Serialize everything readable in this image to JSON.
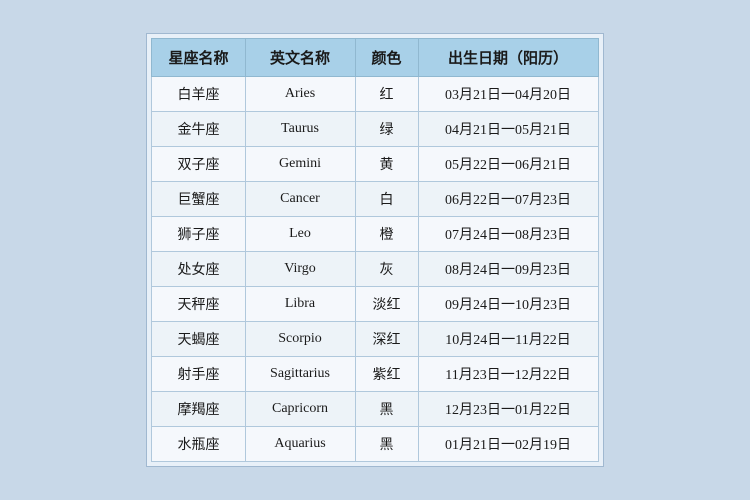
{
  "table": {
    "headers": {
      "chinese_name": "星座名称",
      "english_name": "英文名称",
      "color": "颜色",
      "birth_date": "出生日期（阳历）"
    },
    "rows": [
      {
        "chinese": "白羊座",
        "english": "Aries",
        "color": "红",
        "date": "03月21日一04月20日"
      },
      {
        "chinese": "金牛座",
        "english": "Taurus",
        "color": "绿",
        "date": "04月21日一05月21日"
      },
      {
        "chinese": "双子座",
        "english": "Gemini",
        "color": "黄",
        "date": "05月22日一06月21日"
      },
      {
        "chinese": "巨蟹座",
        "english": "Cancer",
        "color": "白",
        "date": "06月22日一07月23日"
      },
      {
        "chinese": "狮子座",
        "english": "Leo",
        "color": "橙",
        "date": "07月24日一08月23日"
      },
      {
        "chinese": "处女座",
        "english": "Virgo",
        "color": "灰",
        "date": "08月24日一09月23日"
      },
      {
        "chinese": "天秤座",
        "english": "Libra",
        "color": "淡红",
        "date": "09月24日一10月23日"
      },
      {
        "chinese": "天蝎座",
        "english": "Scorpio",
        "color": "深红",
        "date": "10月24日一11月22日"
      },
      {
        "chinese": "射手座",
        "english": "Sagittarius",
        "color": "紫红",
        "date": "11月23日一12月22日"
      },
      {
        "chinese": "摩羯座",
        "english": "Capricorn",
        "color": "黑",
        "date": "12月23日一01月22日"
      },
      {
        "chinese": "水瓶座",
        "english": "Aquarius",
        "color": "黑",
        "date": "01月21日一02月19日"
      }
    ]
  }
}
